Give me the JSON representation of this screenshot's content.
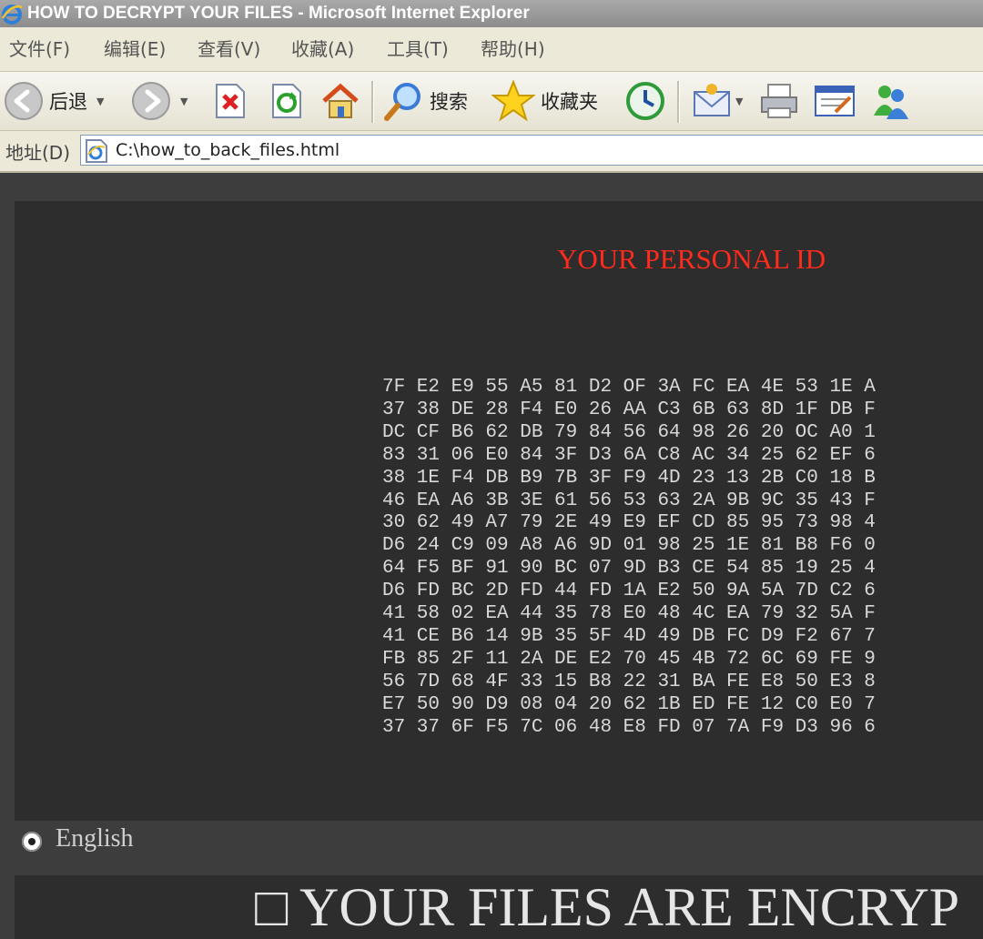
{
  "window": {
    "title": "HOW TO DECRYPT YOUR FILES - Microsoft Internet Explorer"
  },
  "menu": {
    "items": [
      "文件(F)",
      "编辑(E)",
      "查看(V)",
      "收藏(A)",
      "工具(T)",
      "帮助(H)"
    ]
  },
  "toolbar": {
    "back_label": "后退",
    "search_label": "搜索",
    "favorites_label": "收藏夹",
    "icons": [
      "back-icon",
      "forward-icon",
      "stop-icon",
      "refresh-icon",
      "home-icon",
      "search-icon",
      "favorites-icon",
      "history-icon",
      "mail-icon",
      "print-icon",
      "edit-icon",
      "messenger-icon"
    ]
  },
  "address": {
    "label": "地址(D)",
    "url": "C:\\how_to_back_files.html"
  },
  "page": {
    "id_title": "YOUR PERSONAL ID",
    "id_lines": [
      "7F E2 E9 55 A5 81 D2 OF 3A FC EA 4E 53 1E A",
      "37 38 DE 28 F4 E0 26 AA C3 6B 63 8D 1F DB F",
      "DC CF B6 62 DB 79 84 56 64 98 26 20 OC A0 1",
      "83 31 06 E0 84 3F D3 6A C8 AC 34 25 62 EF 6",
      "38 1E F4 DB B9 7B 3F F9 4D 23 13 2B C0 18 B",
      "46 EA A6 3B 3E 61 56 53 63 2A 9B 9C 35 43 F",
      "30 62 49 A7 79 2E 49 E9 EF CD 85 95 73 98 4",
      "D6 24 C9 09 A8 A6 9D 01 98 25 1E 81 B8 F6 0",
      "64 F5 BF 91 90 BC 07 9D B3 CE 54 85 19 25 4",
      "D6 FD BC 2D FD 44 FD 1A E2 50 9A 5A 7D C2 6",
      "41 58 02 EA 44 35 78 E0 48 4C EA 79 32 5A F",
      "41 CE B6 14 9B 35 5F 4D 49 DB FC D9 F2 67 7",
      "FB 85 2F 11 2A DE E2 70 45 4B 72 6C 69 FE 9",
      "56 7D 68 4F 33 15 B8 22 31 BA FE E8 50 E3 8",
      "E7 50 90 D9 08 04 20 62 1B ED FE 12 C0 E0 7",
      "37 37 6F F5 7C 06 48 E8 FD 07 7A F9 D3 96 6"
    ],
    "language_label": "English",
    "banner_text": "□ YOUR FILES ARE ENCRYP"
  },
  "colors": {
    "id_title": "#ff2b1c",
    "panel_bg": "#2d2d2d",
    "page_bg": "#3d3d3d"
  }
}
